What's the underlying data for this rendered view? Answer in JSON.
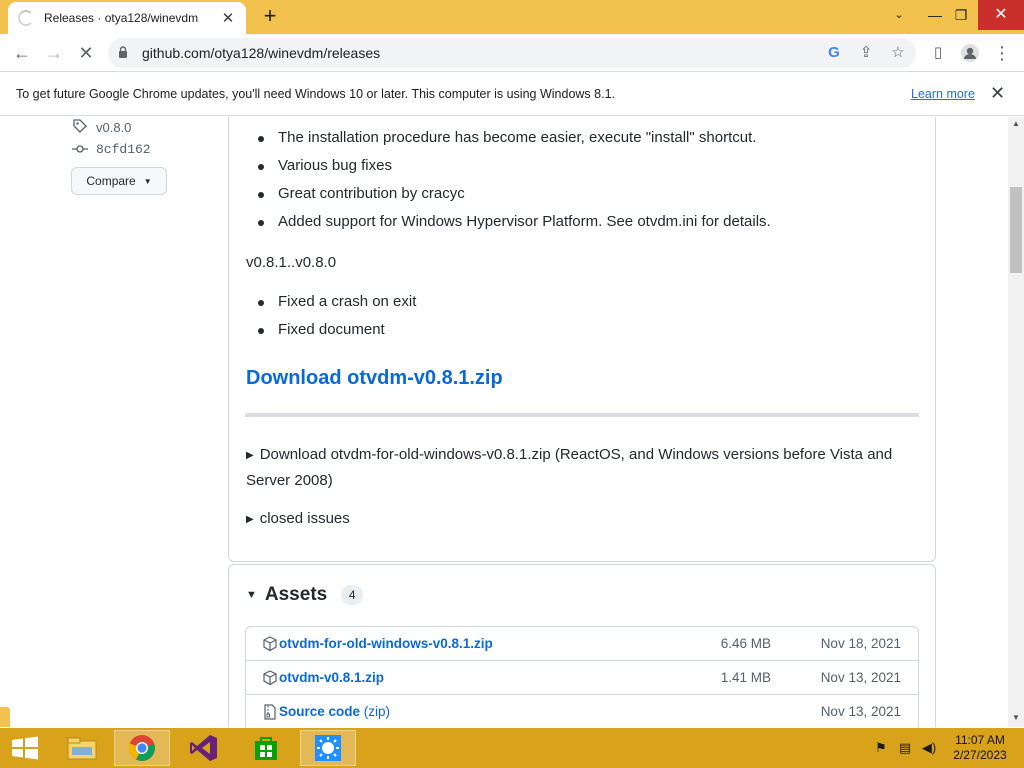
{
  "browser": {
    "tab_title": "Releases · otya128/winevdm",
    "url": "github.com/otya128/winevdm/releases",
    "infobar_message": "To get future Google Chrome updates, you'll need Windows 10 or later. This computer is using Windows 8.1.",
    "infobar_link": "Learn more"
  },
  "sidebar": {
    "tag": "v0.8.0",
    "commit": "8cfd162",
    "compare_label": "Compare"
  },
  "release": {
    "bullets_top": [
      "The installation procedure has become easier, execute \"install\" shortcut.",
      "Various bug fixes",
      "Great contribution by cracyc",
      "Added support for Windows Hypervisor Platform. See otvdm.ini for details."
    ],
    "range_label": "v0.8.1..v0.8.0",
    "bullets_bottom": [
      "Fixed a crash on exit",
      "Fixed document"
    ],
    "download_link": "Download otvdm-v0.8.1.zip",
    "old_windows_details": "Download otvdm-for-old-windows-v0.8.1.zip (ReactOS, and Windows versions before Vista and Server 2008)",
    "closed_issues": "closed issues"
  },
  "assets": {
    "title": "Assets",
    "count": "4",
    "rows": [
      {
        "name": "otvdm-for-old-windows-v0.8.1.zip",
        "sub": "",
        "size": "6.46 MB",
        "date": "Nov 18, 2021"
      },
      {
        "name": "otvdm-v0.8.1.zip",
        "sub": "",
        "size": "1.41 MB",
        "date": "Nov 13, 2021"
      },
      {
        "name": "Source code",
        "sub": " (zip)",
        "size": "",
        "date": "Nov 13, 2021"
      }
    ]
  },
  "taskbar": {
    "time": "11:07 AM",
    "date": "2/27/2023"
  },
  "colors": {
    "link": "#0969da",
    "chrome_frame": "#f2c14e",
    "taskbar": "#d9a21b"
  }
}
